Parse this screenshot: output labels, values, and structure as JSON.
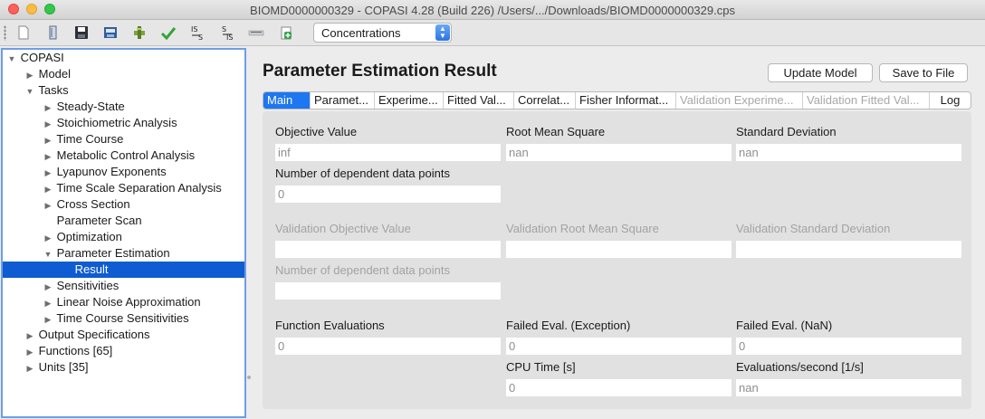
{
  "window": {
    "title": "BIOMD0000000329 - COPASI 4.28 (Build 226) /Users/.../Downloads/BIOMD0000000329.cps"
  },
  "toolbar": {
    "icons": [
      "new-file-icon",
      "open-icon",
      "save-icon",
      "save-as-icon",
      "check-model-icon",
      "accept-icon",
      "import-sbml-icon",
      "export-sbml-icon",
      "slider-icon",
      "add-icon"
    ],
    "combo_value": "Concentrations"
  },
  "tree": {
    "items": [
      {
        "label": "COPASI",
        "arrow": "▼"
      },
      {
        "label": "Model",
        "arrow": "▶"
      },
      {
        "label": "Tasks",
        "arrow": "▼"
      },
      {
        "label": "Steady-State",
        "arrow": "▶"
      },
      {
        "label": "Stoichiometric Analysis",
        "arrow": "▶"
      },
      {
        "label": "Time Course",
        "arrow": "▶"
      },
      {
        "label": "Metabolic Control Analysis",
        "arrow": "▶"
      },
      {
        "label": "Lyapunov Exponents",
        "arrow": "▶"
      },
      {
        "label": "Time Scale Separation Analysis",
        "arrow": "▶"
      },
      {
        "label": "Cross Section",
        "arrow": "▶"
      },
      {
        "label": "Parameter Scan",
        "arrow": ""
      },
      {
        "label": "Optimization",
        "arrow": "▶"
      },
      {
        "label": "Parameter Estimation",
        "arrow": "▼"
      },
      {
        "label": "Result",
        "arrow": ""
      },
      {
        "label": "Sensitivities",
        "arrow": "▶"
      },
      {
        "label": "Linear Noise Approximation",
        "arrow": "▶"
      },
      {
        "label": "Time Course Sensitivities",
        "arrow": "▶"
      },
      {
        "label": "Output Specifications",
        "arrow": "▶"
      },
      {
        "label": "Functions [65]",
        "arrow": "▶"
      },
      {
        "label": "Units [35]",
        "arrow": "▶"
      }
    ]
  },
  "panel": {
    "title": "Parameter Estimation Result",
    "update_model_label": "Update Model",
    "save_to_file_label": "Save to File",
    "tabs": [
      {
        "label": "Main"
      },
      {
        "label": "Paramet..."
      },
      {
        "label": "Experime..."
      },
      {
        "label": "Fitted Val..."
      },
      {
        "label": "Correlat..."
      },
      {
        "label": "Fisher Informat..."
      },
      {
        "label": "Validation Experime..."
      },
      {
        "label": "Validation Fitted Val..."
      },
      {
        "label": "Log"
      }
    ],
    "fields": {
      "objective_value": {
        "label": "Objective Value",
        "value": "inf"
      },
      "root_mean_square": {
        "label": "Root Mean Square",
        "value": "nan"
      },
      "standard_deviation": {
        "label": "Standard Deviation",
        "value": "nan"
      },
      "num_dependent_points": {
        "label": "Number of dependent data points",
        "value": "0"
      },
      "validation_objective_value": {
        "label": "Validation Objective Value",
        "value": ""
      },
      "validation_root_mean_square": {
        "label": "Validation Root Mean Square",
        "value": ""
      },
      "validation_standard_deviation": {
        "label": "Validation Standard Deviation",
        "value": ""
      },
      "validation_num_dependent_points": {
        "label": "Number of dependent data points",
        "value": ""
      },
      "function_evaluations": {
        "label": "Function Evaluations",
        "value": "0"
      },
      "failed_eval_exception": {
        "label": "Failed Eval. (Exception)",
        "value": "0"
      },
      "failed_eval_nan": {
        "label": "Failed Eval. (NaN)",
        "value": "0"
      },
      "cpu_time": {
        "label": "CPU Time [s]",
        "value": "0"
      },
      "evaluations_per_second": {
        "label": "Evaluations/second [1/s]",
        "value": "nan"
      }
    }
  }
}
